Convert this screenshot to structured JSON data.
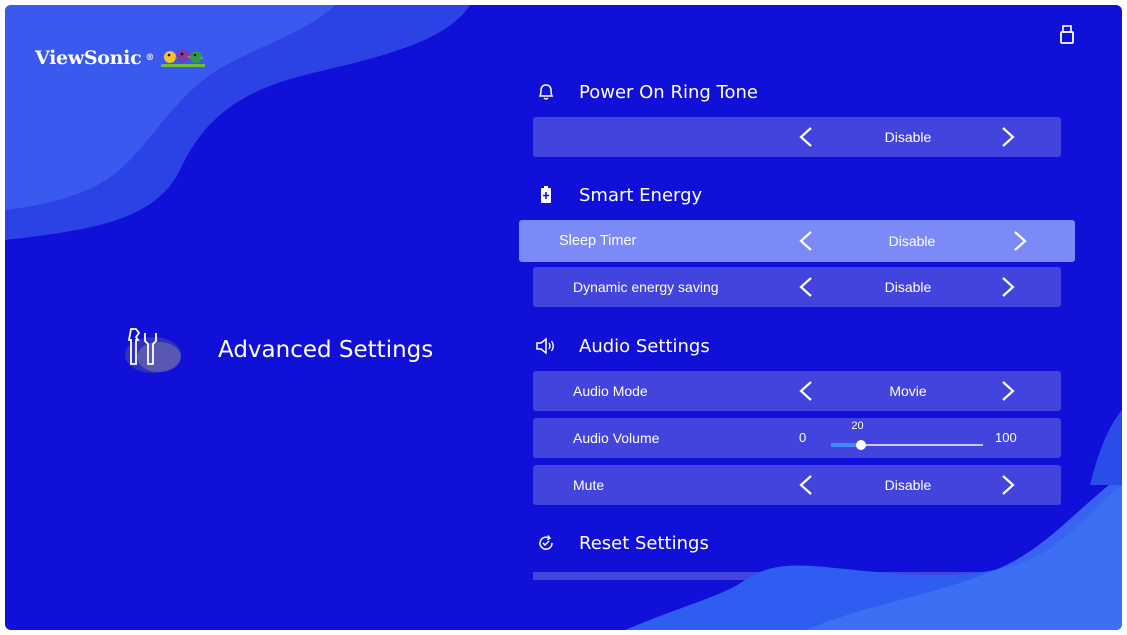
{
  "brand": {
    "name": "ViewSonic",
    "reg_mark": "®"
  },
  "left": {
    "category_title": "Advanced Settings",
    "category_icon": "tools-icon"
  },
  "status": {
    "usb_icon": "usb-icon"
  },
  "sections": {
    "power_ring": {
      "title": "Power On Ring Tone",
      "icon": "bell-icon"
    },
    "smart_energy": {
      "title": "Smart Energy",
      "icon": "battery-icon"
    },
    "audio": {
      "title": "Audio Settings",
      "icon": "speaker-icon"
    },
    "reset": {
      "title": "Reset Settings",
      "icon": "reset-icon"
    }
  },
  "rows": {
    "power_ring": {
      "label": "",
      "value": "Disable"
    },
    "sleep_timer": {
      "label": "Sleep Timer",
      "value": "Disable"
    },
    "dynamic_energy": {
      "label": "Dynamic energy saving",
      "value": "Disable"
    },
    "audio_mode": {
      "label": "Audio Mode",
      "value": "Movie"
    },
    "audio_volume": {
      "label": "Audio Volume",
      "min": "0",
      "max": "100",
      "value": "20",
      "level": 0.2
    },
    "mute": {
      "label": "Mute",
      "value": "Disable"
    }
  },
  "colors": {
    "background": "#1010d8",
    "row": "#4a4ae0",
    "focused_row": "#7c8af7",
    "slider_fill": "#3f8bff"
  }
}
